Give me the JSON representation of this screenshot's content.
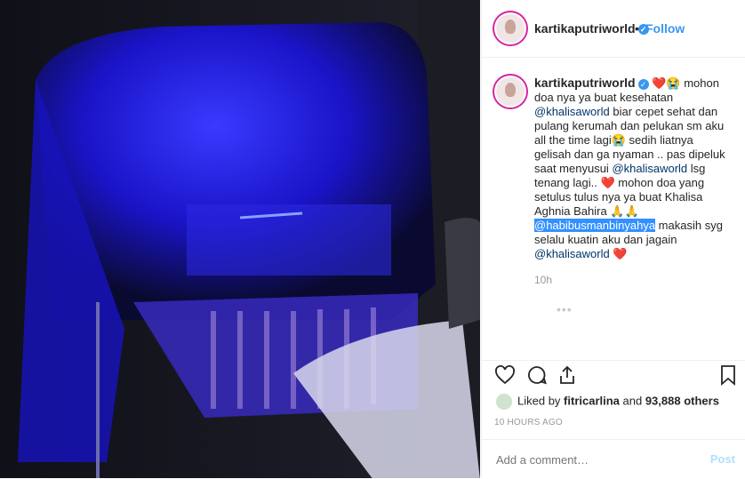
{
  "post": {
    "username": "kartikaputriworld",
    "follow_label": "Follow",
    "separator": "•"
  },
  "caption": {
    "username": "kartikaputriworld",
    "emoji_heart": "❤️",
    "emoji_cry": "😭",
    "emoji_pray": "🙏🙏",
    "t1": " mohon doa nya ya buat kesehatan ",
    "m1": "@khalisaworld",
    "t2": " biar cepet sehat dan pulang kerumah dan pelukan sm aku all the time lagi",
    "t3": " sedih liatnya gelisah dan ga nyaman .. pas dipeluk saat menyusui ",
    "m2": "@khalisaworld",
    "t4": " lsg tenang lagi.. ",
    "t5": " mohon doa yang setulus tulus nya ya buat Khalisa Aghnia Bahira ",
    "m3": "@habibusmanbinyahya",
    "t6": " makasih syg selalu kuatin aku dan jagain ",
    "m4": "@khalisaworld",
    "time": "10h",
    "more": "•••"
  },
  "likes": {
    "prefix": "Liked by ",
    "user": "fitricarlina",
    "middle": " and ",
    "count": "93,888 others"
  },
  "timestamp": "10 HOURS AGO",
  "comment_box": {
    "placeholder": "Add a comment…",
    "post_label": "Post"
  },
  "colors": {
    "accent": "#3897f0",
    "heart": "#ed4956",
    "photo_glow": "#1a1aff"
  }
}
